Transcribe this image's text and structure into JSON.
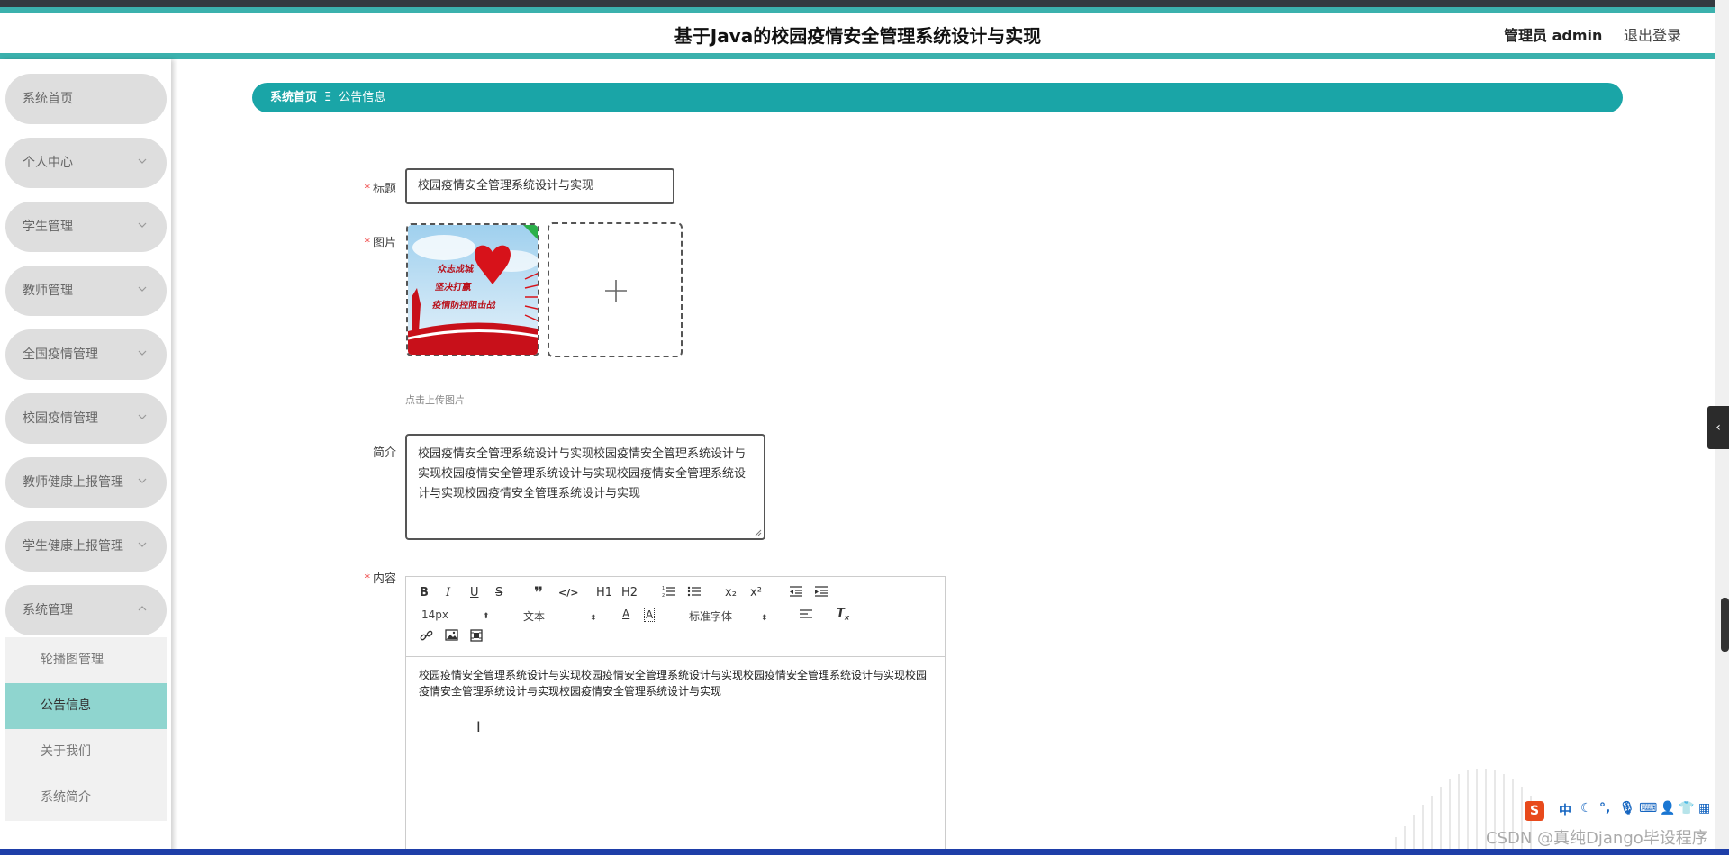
{
  "header": {
    "title": "基于Java的校园疫情安全管理系统设计与实现",
    "user": "管理员 admin",
    "logout": "退出登录"
  },
  "sidebar": {
    "items": [
      {
        "label": "系统首页"
      },
      {
        "label": "个人中心"
      },
      {
        "label": "学生管理"
      },
      {
        "label": "教师管理"
      },
      {
        "label": "全国疫情管理"
      },
      {
        "label": "校园疫情管理"
      },
      {
        "label": "教师健康上报管理"
      },
      {
        "label": "学生健康上报管理"
      },
      {
        "label": "系统管理"
      }
    ],
    "submenu": [
      {
        "label": "轮播图管理"
      },
      {
        "label": "公告信息"
      },
      {
        "label": "关于我们"
      },
      {
        "label": "系统简介"
      }
    ]
  },
  "breadcrumb": {
    "home": "系统首页",
    "separator": "Ξ",
    "current": "公告信息"
  },
  "form": {
    "title_label": "标题",
    "title_value": "校园疫情安全管理系统设计与实现",
    "image_label": "图片",
    "image_text": [
      "众志成城",
      "坚决打赢",
      "疫情防控阻击战"
    ],
    "upload_hint": "点击上传图片",
    "summary_label": "简介",
    "summary_value": "校园疫情安全管理系统设计与实现校园疫情安全管理系统设计与实现校园疫情安全管理系统设计与实现校园疫情安全管理系统设计与实现校园疫情安全管理系统设计与实现",
    "content_label": "内容",
    "content_value": "校园疫情安全管理系统设计与实现校园疫情安全管理系统设计与实现校园疫情安全管理系统设计与实现校园疫情安全管理系统设计与实现校园疫情安全管理系统设计与实现"
  },
  "editor": {
    "font_size": "14px",
    "text_type": "文本",
    "font_family": "标准字体",
    "h1": "H1",
    "h2": "H2",
    "sub": "x₂",
    "sup": "x²"
  },
  "ime": {
    "mode": "中"
  },
  "watermark": "CSDN @真纯Django毕设程序",
  "colors": {
    "accent": "#1aa5a7",
    "header_teal": "#3bb1ad",
    "active_submenu": "#8fd5cf",
    "required": "#e33"
  }
}
